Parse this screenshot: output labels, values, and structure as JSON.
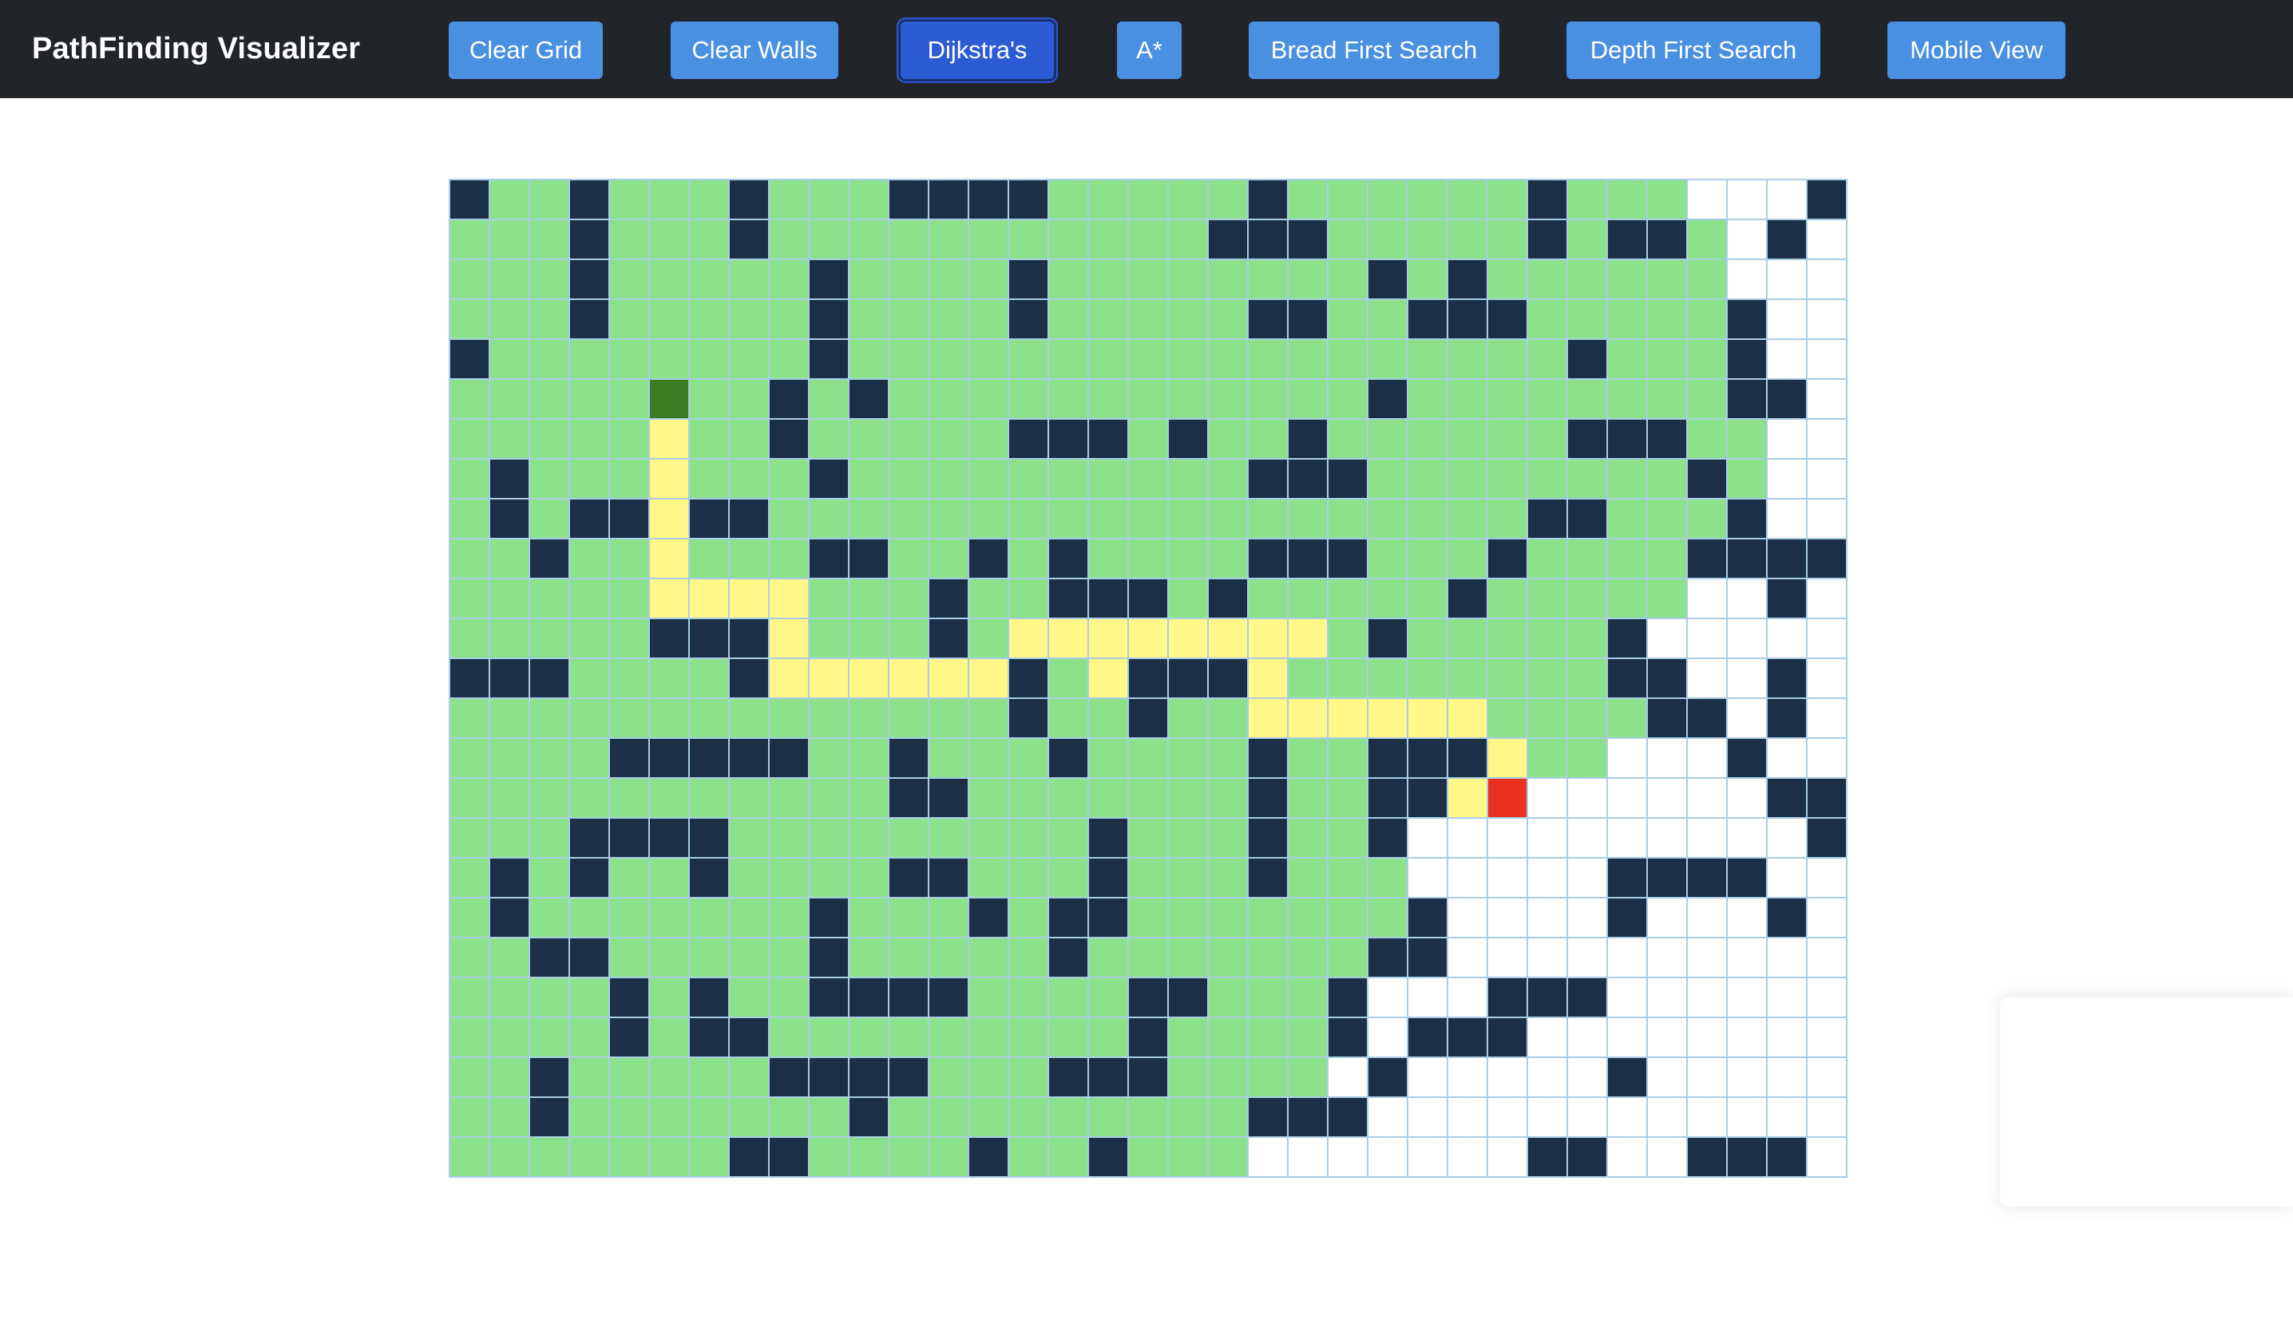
{
  "app": {
    "title": "PathFinding Visualizer"
  },
  "toolbar": {
    "buttons": [
      {
        "label": "Clear Grid",
        "active": false
      },
      {
        "label": "Clear Walls",
        "active": false
      },
      {
        "label": "Dijkstra's",
        "active": true
      },
      {
        "label": "A*",
        "active": false
      },
      {
        "label": "Bread First Search",
        "active": false
      },
      {
        "label": "Depth First Search",
        "active": false
      },
      {
        "label": "Mobile View",
        "active": false
      }
    ]
  },
  "colors": {
    "navbar": "#212529",
    "button": "#4a90e2",
    "button_active": "#2d5bd4",
    "unvisited": "#ffffff",
    "visited": "#8ce28a",
    "wall": "#1b3046",
    "path": "#fff787",
    "start": "#3a7d22",
    "end": "#e8311f",
    "grid_line": "#a9cde6"
  },
  "grid": {
    "rows": 25,
    "cols": 35,
    "legend": {
      "0": "unvisited",
      "1": "visited",
      "2": "wall",
      "3": "shortest-path",
      "4": "start-node",
      "5": "end-node"
    },
    "start": [
      5,
      5
    ],
    "end": [
      15,
      25
    ],
    "cells": [
      "21121112111222211111211111121110002",
      "11121112111111111112221111121221020",
      "11121111121111211111111212111111000",
      "11121111121111211111221122211111200",
      "21111111121111111111111111112111200",
      "11111411212111111111111211111111220",
      "11111311211111222121121111112221100",
      "12111311121111111111222111111112100",
      "12122322111111111111111111122111200",
      "11211311122112121111222111211112222",
      "11111333311121122212111112111110020",
      "11111222311121333333331211111200000",
      "22211112333333213222311111111220020",
      "11111111111111211211333333111122020",
      "11112222211211121111211222311000200",
      "11111111111221111111211223500000022",
      "11122221111111112111211200000000002",
      "12121121111221112111211100000222200",
      "12111111121112122111111120000200020",
      "11221111121111121111111220000000000",
      "11112121122221111221112000222000000",
      "11112122111111111211112022200000000",
      "11211111222211122211110200000200000",
      "11211111112111111111222000000000000",
      "11111112211112112111000000022002220"
    ]
  }
}
